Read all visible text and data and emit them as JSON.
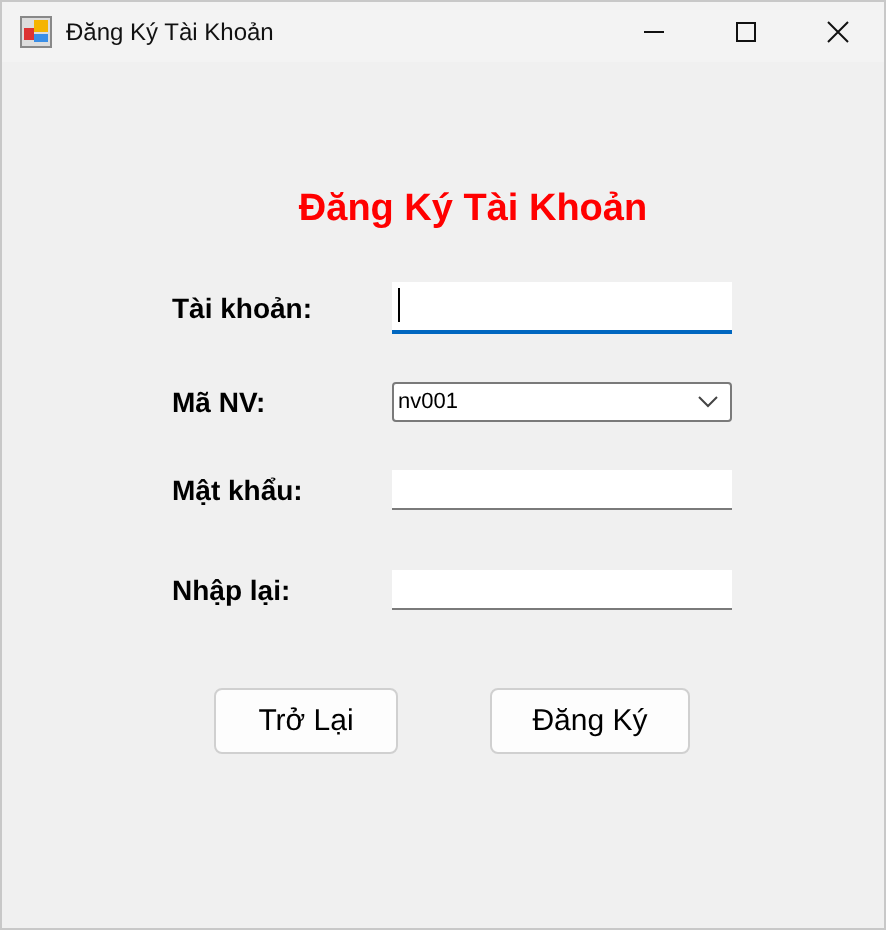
{
  "window": {
    "title": "Đăng Ký Tài Khoản"
  },
  "heading": "Đăng Ký Tài Khoản",
  "fields": [
    {
      "label": "Tài khoản:",
      "kind": "text",
      "focused": true
    },
    {
      "label": "Mã NV:",
      "kind": "dropdown",
      "value": "nv001",
      "focused": false
    },
    {
      "label": "Mật khẩu:",
      "kind": "text",
      "focused": false
    },
    {
      "label": "Nhập lại:",
      "kind": "text",
      "focused": false
    }
  ],
  "buttons": [
    "Trở Lại",
    "Đăng Ký"
  ]
}
